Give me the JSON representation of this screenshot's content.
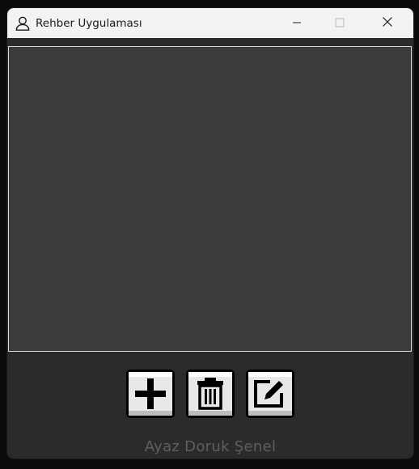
{
  "window": {
    "title": "Rehber Uygulaması",
    "app_icon": "person-icon",
    "controls": [
      "minimize-icon",
      "maximize-icon",
      "close-icon"
    ]
  },
  "contact_list": {
    "items": []
  },
  "toolbar": {
    "buttons": [
      {
        "icon": "add-icon"
      },
      {
        "icon": "trash-icon"
      },
      {
        "icon": "edit-icon"
      }
    ]
  },
  "footer": {
    "author": "Ayaz Doruk Şenel"
  },
  "colors": {
    "titlebar_bg": "#f3f3f3",
    "window_bg": "#2b2b2b",
    "list_bg": "#3b3b3b",
    "list_border": "#d8d8d8",
    "footer_text": "#5f5f5f"
  }
}
